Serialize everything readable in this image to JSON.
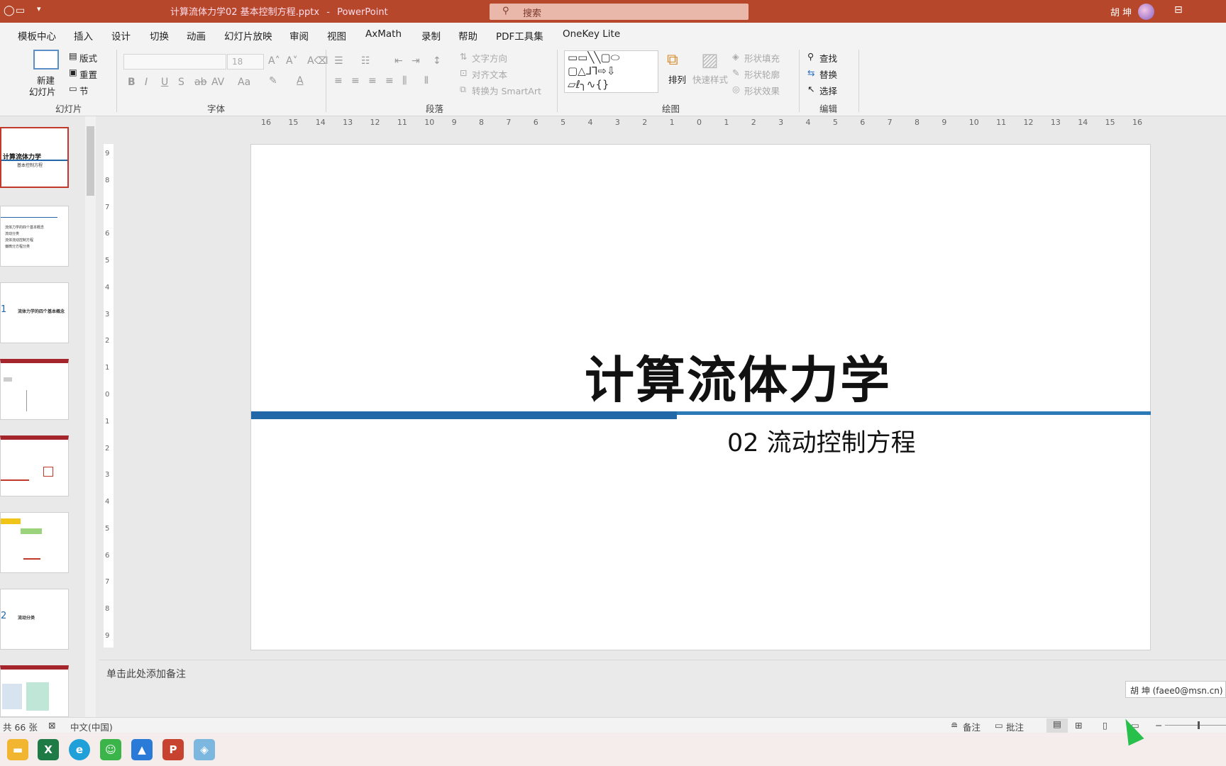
{
  "titlebar": {
    "document": "计算流体力学02 基本控制方程.pptx",
    "separator": "-",
    "app": "PowerPoint",
    "search_placeholder": "搜索",
    "user": "胡 坤"
  },
  "tabs": [
    "模板中心",
    "插入",
    "设计",
    "切换",
    "动画",
    "幻灯片放映",
    "审阅",
    "视图",
    "AxMath",
    "录制",
    "帮助",
    "PDF工具集",
    "OneKey Lite"
  ],
  "ribbon": {
    "slides": {
      "new_slide_1": "新建",
      "new_slide_2": "幻灯片",
      "layout": "版式",
      "reset": "重置",
      "section": "节",
      "label": "幻灯片"
    },
    "font": {
      "font_size": "18",
      "label": "字体"
    },
    "paragraph": {
      "text_direction": "文字方向",
      "align_text": "对齐文本",
      "smartart": "转换为 SmartArt",
      "label": "段落"
    },
    "drawing": {
      "arrange": "排列",
      "quick_styles": "快速样式",
      "shape_fill": "形状填充",
      "shape_outline": "形状轮廓",
      "shape_effects": "形状效果",
      "label": "绘图"
    },
    "editing": {
      "find": "查找",
      "replace": "替换",
      "select": "选择",
      "label": "编辑"
    }
  },
  "hruler_ticks": [
    "16",
    "15",
    "14",
    "13",
    "12",
    "11",
    "10",
    "9",
    "8",
    "7",
    "6",
    "5",
    "4",
    "3",
    "2",
    "1",
    "0",
    "1",
    "2",
    "3",
    "4",
    "5",
    "6",
    "7",
    "8",
    "9",
    "10",
    "11",
    "12",
    "13",
    "14",
    "15",
    "16"
  ],
  "vruler_ticks": [
    "9",
    "8",
    "7",
    "6",
    "5",
    "4",
    "3",
    "2",
    "1",
    "0",
    "1",
    "2",
    "3",
    "4",
    "5",
    "6",
    "7",
    "8",
    "9"
  ],
  "thumbs": [
    {
      "title": "计算流体力学",
      "sub": "基本控制方程"
    },
    {
      "lines": [
        "流体力学的四个基本概念",
        "流动分类",
        "流体流动控制方程",
        "偏微分方程分类"
      ]
    },
    {
      "num": "1",
      "title": "流体力学的四个基本概念"
    },
    {},
    {},
    {},
    {
      "num": "2",
      "title": "流动分类"
    },
    {}
  ],
  "slide": {
    "title": "计算流体力学",
    "subtitle": "02 流动控制方程"
  },
  "notes_placeholder": "单击此处添加备注",
  "tooltip": "胡 坤 (faee0@msn.cn)",
  "status": {
    "slide_count": "共 66 张",
    "language": "中文(中国)",
    "notes": "备注",
    "comments": "批注"
  }
}
